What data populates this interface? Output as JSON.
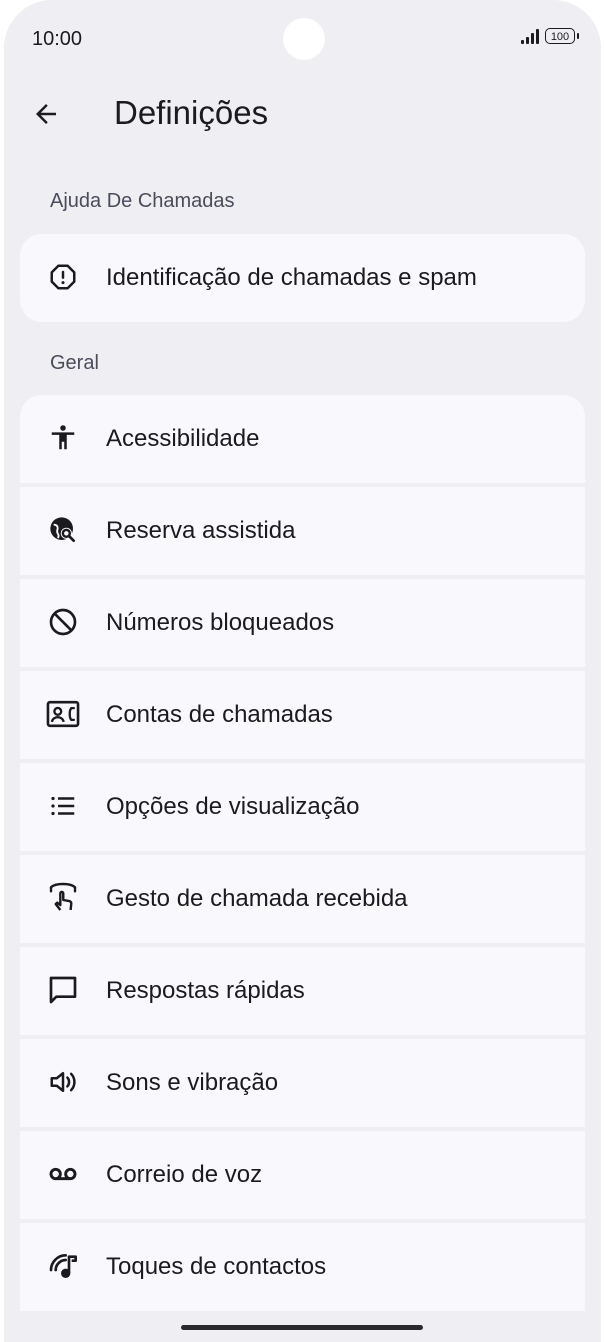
{
  "status_bar": {
    "time": "10:00",
    "battery": "100"
  },
  "header": {
    "title": "Definições"
  },
  "sections": {
    "call_assist": {
      "title": "Ajuda De Chamadas",
      "items": [
        {
          "label": "Identificação de chamadas e spam",
          "icon": "alert-octagon-icon"
        }
      ]
    },
    "general": {
      "title": "Geral",
      "items": [
        {
          "label": "Acessibilidade",
          "icon": "accessibility-icon"
        },
        {
          "label": "Reserva assistida",
          "icon": "assisted-booking-icon"
        },
        {
          "label": "Números bloqueados",
          "icon": "block-icon"
        },
        {
          "label": "Contas de chamadas",
          "icon": "contact-calling-icon"
        },
        {
          "label": "Opções de visualização",
          "icon": "list-icon"
        },
        {
          "label": "Gesto de chamada recebida",
          "icon": "swipe-gesture-icon"
        },
        {
          "label": "Respostas rápidas",
          "icon": "message-icon"
        },
        {
          "label": "Sons e vibração",
          "icon": "volume-icon"
        },
        {
          "label": "Correio de voz",
          "icon": "voicemail-icon"
        },
        {
          "label": "Toques de contactos",
          "icon": "ringtone-icon"
        }
      ]
    }
  }
}
